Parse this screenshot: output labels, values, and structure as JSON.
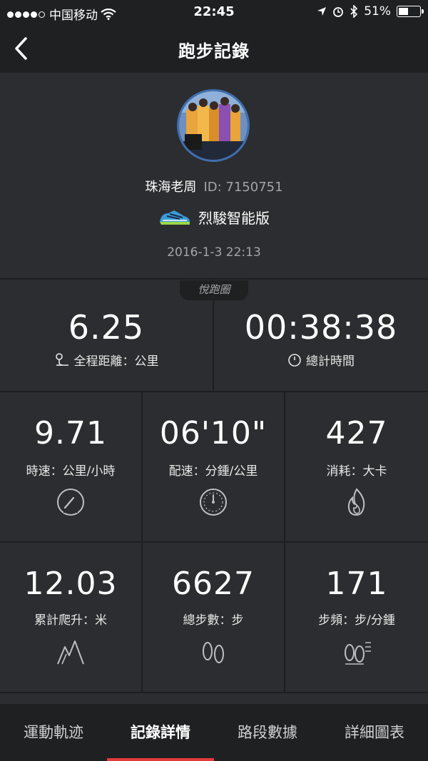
{
  "status": {
    "carrier": "中国移动",
    "time": "22:45",
    "battery": "51%",
    "battery_level": 0.51
  },
  "nav": {
    "title": "跑步記錄"
  },
  "profile": {
    "name": "珠海老周",
    "id_text": "ID: 7150751",
    "device": "烈駿智能版",
    "date": "2016-1-3 22:13"
  },
  "badge": "悅跑圈",
  "stats": {
    "distance": {
      "value": "6.25",
      "label": "全程距離：公里"
    },
    "duration": {
      "value": "00:38:38",
      "label": "總計時間"
    },
    "speed": {
      "value": "9.71",
      "label": "時速：公里/小時"
    },
    "pace": {
      "value": "06'10\"",
      "label": "配速：分鍾/公里"
    },
    "calories": {
      "value": "427",
      "label": "消耗：大卡"
    },
    "climb": {
      "value": "12.03",
      "label": "累計爬升：米"
    },
    "steps": {
      "value": "6627",
      "label": "總步數：步"
    },
    "cadence": {
      "value": "171",
      "label": "步頻：步/分鍾"
    }
  },
  "tabs": [
    {
      "label": "運動軌迹"
    },
    {
      "label": "記錄詳情"
    },
    {
      "label": "路段數據"
    },
    {
      "label": "詳細圖表"
    }
  ],
  "colors": {
    "accent": "#e23b3b",
    "background": "#2c2d30",
    "bar": "#1f2022"
  }
}
